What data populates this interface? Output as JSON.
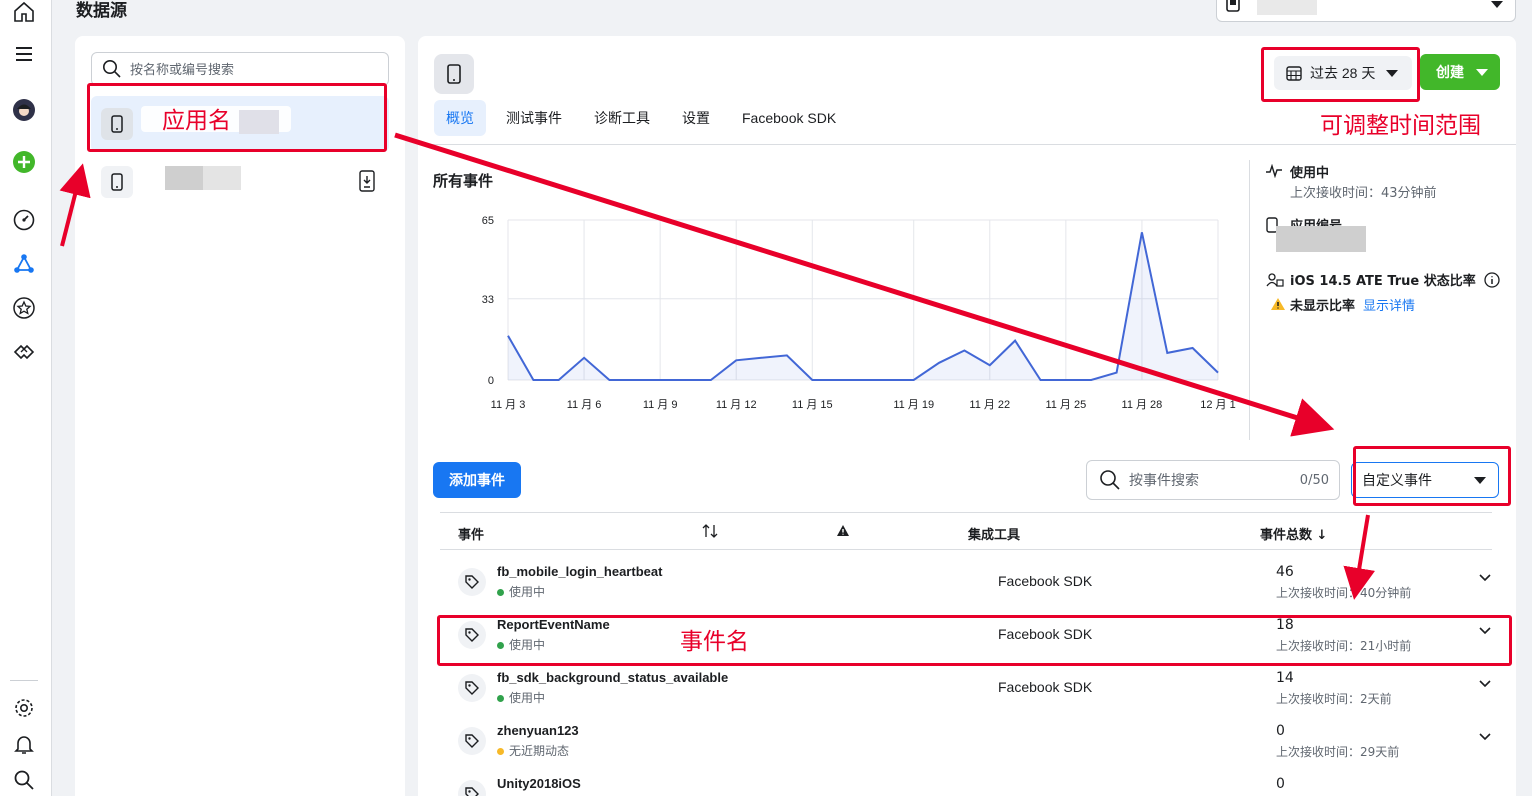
{
  "page": {
    "title": "数据源"
  },
  "search": {
    "placeholder": "按名称或编号搜索"
  },
  "tabs": [
    "概览",
    "测试事件",
    "诊断工具",
    "设置",
    "Facebook SDK"
  ],
  "header": {
    "date_range": "过去 28 天",
    "create_label": "创建"
  },
  "chart_title": "所有事件",
  "chart_data": {
    "type": "area",
    "x": [
      "11 月 3",
      "11 月 4",
      "11 月 5",
      "11 月 6",
      "11 月 7",
      "11 月 8",
      "11 月 9",
      "11 月 10",
      "11 月 11",
      "11 月 12",
      "11 月 13",
      "11 月 14",
      "11 月 15",
      "11 月 16",
      "11 月 17",
      "11 月 18",
      "11 月 19",
      "11 月 20",
      "11 月 21",
      "11 月 22",
      "11 月 23",
      "11 月 24",
      "11 月 25",
      "11 月 26",
      "11 月 27",
      "11 月 28",
      "11 月 29",
      "11 月 30",
      "12 月 1"
    ],
    "series": [
      {
        "values": [
          18,
          0,
          0,
          9,
          0,
          0,
          0,
          0,
          0,
          8,
          9,
          10,
          0,
          0,
          0,
          0,
          0,
          7,
          12,
          6,
          16,
          0,
          0,
          0,
          3,
          60,
          11,
          13,
          3
        ]
      }
    ],
    "tick_labels": [
      "11 月 3",
      "11 月 6",
      "11 月 9",
      "11 月 12",
      "11 月 15",
      "11 月 19",
      "11 月 22",
      "11 月 25",
      "11 月 28",
      "12 月 1"
    ],
    "y_ticks": [
      "0",
      "33",
      "65"
    ],
    "ylim": [
      0,
      65
    ],
    "grid": true,
    "color": "#4267d6"
  },
  "side": {
    "status": "使用中",
    "last_received": "上次接收时间：43分钟前",
    "app_id_label": "应用编号",
    "ate_label": "iOS 14.5 ATE True 状态比率",
    "ate_warn": "未显示比率",
    "ate_link": "显示详情"
  },
  "events_toolbar": {
    "add_label": "添加事件",
    "search_placeholder": "按事件搜索",
    "search_count": "0/50",
    "filter_label": "自定义事件"
  },
  "table": {
    "headers": {
      "event": "事件",
      "tool": "集成工具",
      "total": "事件总数 ↓"
    },
    "rows": [
      {
        "name": "fb_mobile_login_heartbeat",
        "status": "使用中",
        "tool": "Facebook SDK",
        "count": "46",
        "last": "上次接收时间：40分钟前"
      },
      {
        "name": "ReportEventName",
        "status": "使用中",
        "tool": "Facebook SDK",
        "count": "18",
        "last": "上次接收时间：21小时前"
      },
      {
        "name": "fb_sdk_background_status_available",
        "status": "使用中",
        "tool": "Facebook SDK",
        "count": "14",
        "last": "上次接收时间：2天前"
      },
      {
        "name": "zhenyuan123",
        "status": "无近期动态",
        "tool": "",
        "count": "0",
        "last": "上次接收时间：29天前"
      },
      {
        "name": "Unity2018iOS",
        "status": "",
        "tool": "",
        "count": "0",
        "last": ""
      }
    ]
  },
  "annotations": {
    "app_name": "应用名",
    "time_range": "可调整时间范围",
    "event_name": "事件名"
  },
  "colors": {
    "primary": "#1877f2",
    "green": "#42b72a",
    "annotation": "#e8002a",
    "active_dot": "#31a24c",
    "idle_dot": "#f7b928"
  }
}
